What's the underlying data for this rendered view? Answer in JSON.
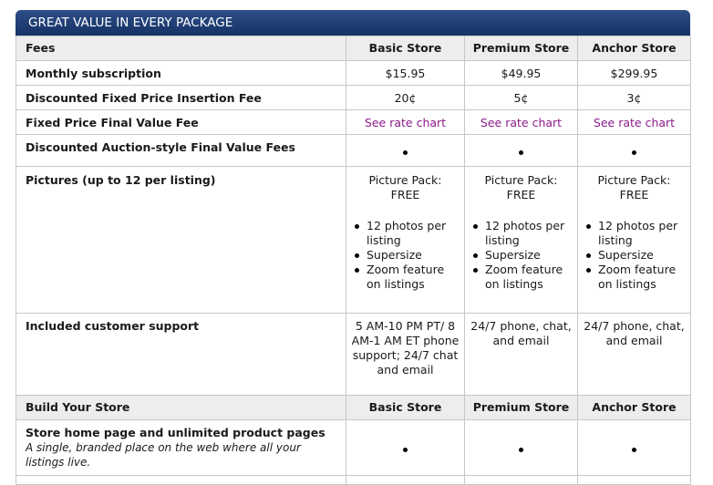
{
  "banner": {
    "title": "GREAT VALUE IN EVERY PACKAGE"
  },
  "header": {
    "fees": "Fees",
    "basic": "Basic Store",
    "premium": "Premium Store",
    "anchor": "Anchor Store"
  },
  "rows": {
    "monthly": {
      "label": "Monthly subscription",
      "basic": "$15.95",
      "premium": "$49.95",
      "anchor": "$299.95"
    },
    "insertion": {
      "label": "Discounted Fixed Price Insertion Fee",
      "basic": "20¢",
      "premium": "5¢",
      "anchor": "3¢"
    },
    "final_value": {
      "label": "Fixed Price Final Value Fee",
      "basic": "See rate chart",
      "premium": "See rate chart",
      "anchor": "See rate chart"
    },
    "auction": {
      "label": "Discounted Auction-style Final Value Fees"
    },
    "pictures": {
      "label": "Pictures (up to 12 per listing)",
      "pack": "Picture Pack:",
      "free": "FREE",
      "features": [
        "12 photos per listing",
        "Supersize",
        "Zoom feature on listings"
      ]
    },
    "support": {
      "label": "Included customer support",
      "basic": "5 AM-10 PM PT/ 8 AM-1 AM ET phone support; 24/7 chat and email",
      "premium": "24/7 phone, chat, and email",
      "anchor": "24/7 phone, chat, and email"
    }
  },
  "build": {
    "title": "Build Your Store",
    "basic": "Basic Store",
    "premium": "Premium Store",
    "anchor": "Anchor Store"
  },
  "store_row": {
    "label": "Store home page and unlimited product pages",
    "sub": "A single, branded place on the web where all your listings live."
  }
}
